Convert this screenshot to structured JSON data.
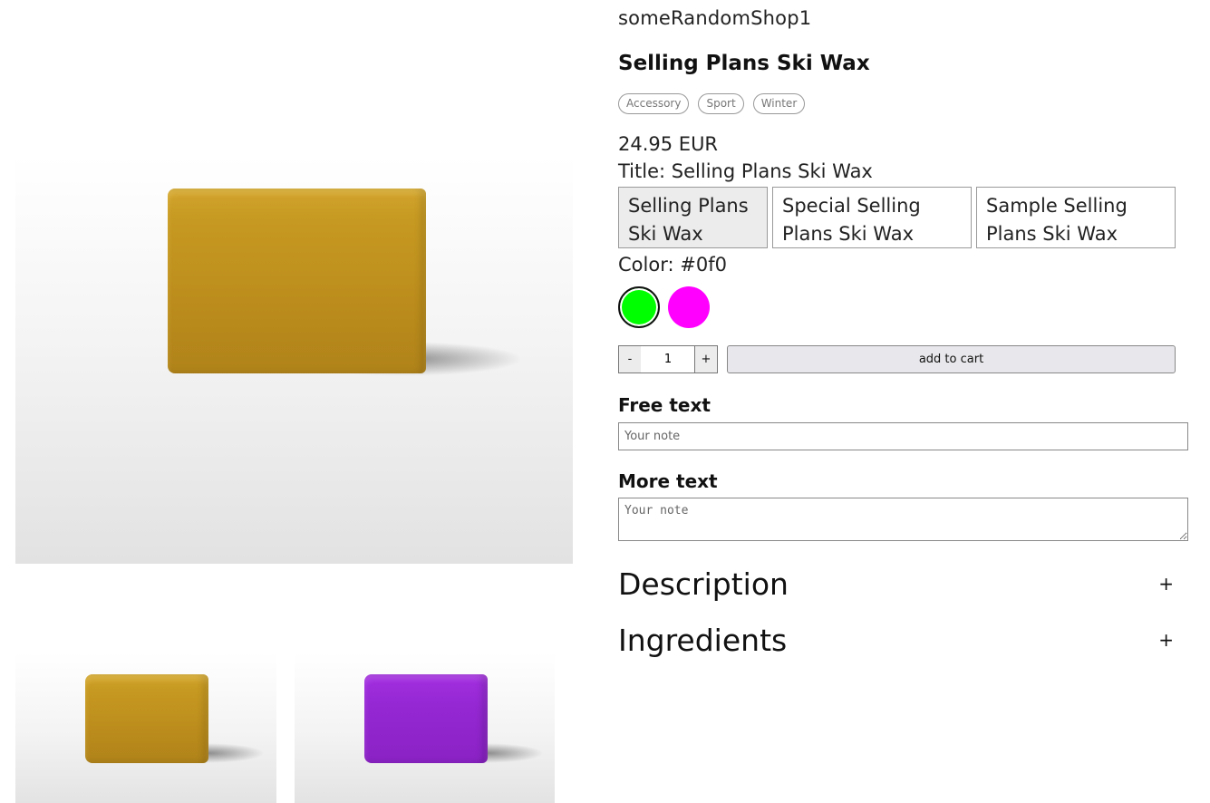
{
  "shop": {
    "name": "someRandomShop1"
  },
  "product": {
    "title": "Selling Plans Ski Wax",
    "tags": [
      "Accessory",
      "Sport",
      "Winter"
    ],
    "price": "24.95 EUR"
  },
  "options": {
    "title": {
      "label": "Title:",
      "selected": "Selling Plans Ski Wax",
      "values": [
        "Selling Plans Ski Wax",
        "Special Selling Plans Ski Wax",
        "Sample Selling Plans Ski Wax"
      ]
    },
    "color": {
      "label": "Color:",
      "selected": "#0f0",
      "swatches": [
        {
          "name": "green",
          "hex": "#0f0",
          "selected": true
        },
        {
          "name": "magenta",
          "hex": "#f0f",
          "selected": false
        }
      ]
    }
  },
  "cart": {
    "minus": "-",
    "plus": "+",
    "quantity": "1",
    "add_label": "add to cart"
  },
  "fields": {
    "free_text": {
      "label": "Free text",
      "placeholder": "Your note"
    },
    "more_text": {
      "label": "More text",
      "placeholder": "Your note"
    }
  },
  "accordions": [
    {
      "title": "Description",
      "icon": "+"
    },
    {
      "title": "Ingredients",
      "icon": "+"
    }
  ],
  "gallery": {
    "main": "gold-wax-image",
    "thumbnails": [
      "gold-wax-thumbnail",
      "purple-wax-thumbnail"
    ]
  }
}
